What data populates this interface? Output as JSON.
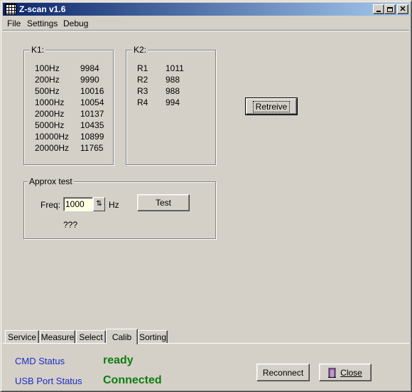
{
  "window": {
    "title": "Z-scan v1.6"
  },
  "menu": {
    "items": [
      "File",
      "Settings",
      "Debug"
    ]
  },
  "k1": {
    "label": "K1:",
    "rows": [
      {
        "freq": "100Hz",
        "value": "9984"
      },
      {
        "freq": "200Hz",
        "value": "9990"
      },
      {
        "freq": "500Hz",
        "value": "10016"
      },
      {
        "freq": "1000Hz",
        "value": "10054"
      },
      {
        "freq": "2000Hz",
        "value": "10137"
      },
      {
        "freq": "5000Hz",
        "value": "10435"
      },
      {
        "freq": "10000Hz",
        "value": "10899"
      },
      {
        "freq": "20000Hz",
        "value": "11765"
      }
    ]
  },
  "k2": {
    "label": "K2:",
    "rows": [
      {
        "name": "R1",
        "value": "1011"
      },
      {
        "name": "R2",
        "value": "988"
      },
      {
        "name": "R3",
        "value": "988"
      },
      {
        "name": "R4",
        "value": "994"
      }
    ]
  },
  "retrieve_button": "Retreive",
  "approx_test": {
    "label": "Approx test",
    "freq_label": "Freq:",
    "freq_value": "1000",
    "unit": "Hz",
    "test_button": "Test",
    "result": "???"
  },
  "tabs": [
    "Service",
    "Measure",
    "Select",
    "Calib",
    "Sorting"
  ],
  "active_tab": "Calib",
  "status": {
    "cmd_label": "CMD Status",
    "cmd_value": "ready",
    "usb_label": "USB Port Status",
    "usb_value": "Connected",
    "label_color": "#1f2cc4",
    "value_color": "#0f7d0f"
  },
  "buttons": {
    "reconnect": "Reconnect",
    "close": "Close"
  }
}
